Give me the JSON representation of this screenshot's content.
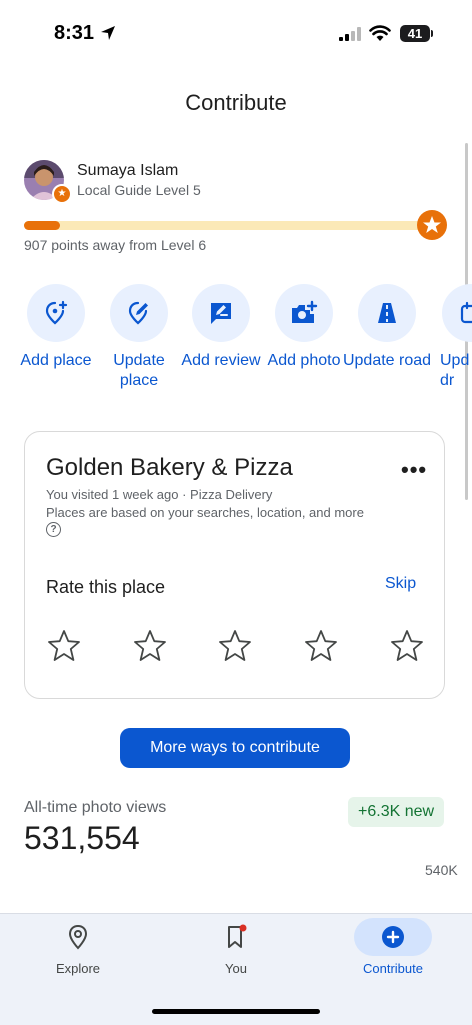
{
  "status_bar": {
    "time": "8:31",
    "battery": "41"
  },
  "page_title": "Contribute",
  "profile": {
    "name": "Sumaya Islam",
    "level": "Local Guide Level 5",
    "progress": 0.09,
    "points_text": "907 points away from Level 6"
  },
  "actions": [
    {
      "label": "Add place",
      "icon": "add-place-icon"
    },
    {
      "label": "Update place",
      "icon": "edit-place-icon"
    },
    {
      "label": "Add review",
      "icon": "add-review-icon"
    },
    {
      "label": "Add photo",
      "icon": "add-photo-icon"
    },
    {
      "label": "Update road",
      "icon": "road-icon"
    },
    {
      "label": "Upd addr",
      "icon": "update-address-icon"
    }
  ],
  "place_card": {
    "name": "Golden Bakery & Pizza",
    "visit": "You visited 1 week ago · Pizza Delivery",
    "reason": "Places are based on your searches, location, and more",
    "help": "?",
    "rate_label": "Rate this place",
    "skip": "Skip",
    "stars": 5
  },
  "more_ways": "More ways to contribute",
  "stats": {
    "label": "All-time photo views",
    "value": "531,554",
    "delta": "+6.3K new",
    "axis_label": "540K"
  },
  "nav": [
    {
      "label": "Explore",
      "icon": "explore-pin-icon"
    },
    {
      "label": "You",
      "icon": "bookmark-icon"
    },
    {
      "label": "Contribute",
      "icon": "contribute-plus-icon"
    }
  ],
  "colors": {
    "accent": "#0b57d0",
    "guide_orange": "#e8710a",
    "progress_track": "#fbe9b7",
    "positive_green": "#137333"
  }
}
